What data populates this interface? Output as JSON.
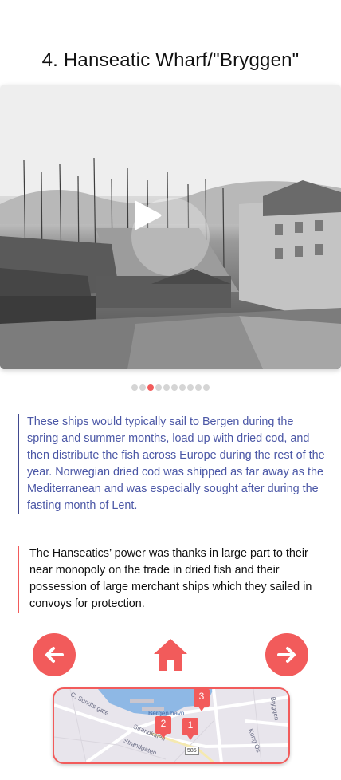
{
  "page": {
    "title": "4. Hanseatic Wharf/\"Bryggen\""
  },
  "media": {
    "image_description_icon": "play-icon",
    "carousel": {
      "count": 10,
      "active_index": 2
    }
  },
  "text": {
    "quote1": "These ships would typically sail to Bergen during the spring and summer months, load up with dried cod, and then distribute the fish across Europe during the rest of the year. Norwegian dried cod was shipped as far away as the Mediterranean and was especially sought after during the fasting month of Lent.",
    "quote2": "The Hanseatics’ power was thanks in large part to their near monopoly on the trade in dried fish and their possession of large merchant ships which they sailed in convoys for protection."
  },
  "nav": {
    "prev_icon": "arrow-left-icon",
    "home_icon": "home-icon",
    "next_icon": "arrow-right-icon"
  },
  "map": {
    "labels": {
      "street1": "C. Sundts gate",
      "street2": "Strandkaien",
      "street3": "Strandgaten",
      "street4": "Kong Os",
      "street5": "Bryggen",
      "harbour": "Bergen havn",
      "road_number": "585"
    },
    "markers": [
      {
        "label": "3"
      },
      {
        "label": "2"
      },
      {
        "label": "1"
      }
    ]
  },
  "colors": {
    "accent": "#f25b5b",
    "quote_blue": "#4b57a6",
    "quote_bar_blue": "#41498f"
  }
}
